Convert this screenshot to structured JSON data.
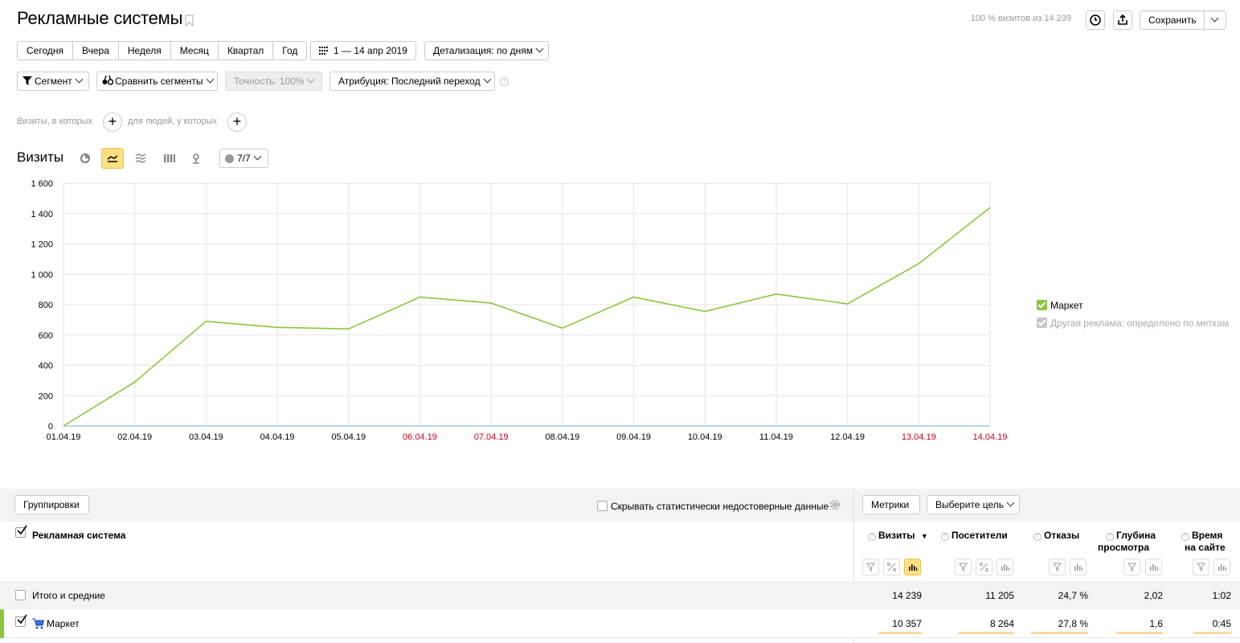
{
  "header": {
    "title": "Рекламные системы",
    "visits_info": "100 % визитов из 14 239",
    "save_label": "Сохранить"
  },
  "period": {
    "buttons": [
      "Сегодня",
      "Вчера",
      "Неделя",
      "Месяц",
      "Квартал",
      "Год"
    ],
    "date_range": "1 — 14 апр 2019",
    "detail": "Детализация: по дням"
  },
  "filters": {
    "segment": "Сегмент",
    "compare": "Сравнить сегменты",
    "accuracy": "Точность: 100%",
    "attribution": "Атрибуция: Последний переход"
  },
  "conditions": {
    "visits_label": "Визиты, в которых",
    "people_label": "для людей, у которых"
  },
  "chart_section": {
    "title": "Визиты",
    "series_counter": "7/7"
  },
  "chart_data": {
    "type": "line",
    "x": [
      "01.04.19",
      "02.04.19",
      "03.04.19",
      "04.04.19",
      "05.04.19",
      "06.04.19",
      "07.04.19",
      "08.04.19",
      "09.04.19",
      "10.04.19",
      "11.04.19",
      "12.04.19",
      "13.04.19",
      "14.04.19"
    ],
    "weekend": [
      false,
      false,
      false,
      false,
      false,
      true,
      true,
      false,
      false,
      false,
      false,
      false,
      true,
      true
    ],
    "yticks": [
      0,
      200,
      400,
      600,
      800,
      1000,
      1200,
      1400,
      1600
    ],
    "ytick_labels": [
      "0",
      "200",
      "400",
      "600",
      "800",
      "1 000",
      "1 200",
      "1 400",
      "1 600"
    ],
    "ylim": [
      0,
      1600
    ],
    "series": [
      {
        "name": "Маркет",
        "color": "#8cc63f",
        "values": [
          0,
          290,
          690,
          650,
          640,
          850,
          810,
          645,
          850,
          755,
          870,
          805,
          1070,
          1440
        ]
      },
      {
        "name": "Другая реклама: определено по меткам",
        "color": "#9ecae1",
        "values": [
          0,
          0,
          0,
          0,
          0,
          0,
          0,
          0,
          0,
          0,
          0,
          0,
          0,
          0
        ]
      }
    ],
    "grid": true,
    "legend": "right"
  },
  "table_toolbar": {
    "groupings": "Группировки",
    "hide_label": "Скрывать статистически недостоверные данные",
    "metrics": "Метрики",
    "goal": "Выберите цель"
  },
  "table": {
    "dimension_header": "Рекламная система",
    "columns": [
      {
        "label": "Визиты",
        "sorted": "▼"
      },
      {
        "label": "Посетители"
      },
      {
        "label": "Отказы"
      },
      {
        "label": "Глубина просмотра",
        "line1": "Глубина",
        "line2": "просмотра"
      },
      {
        "label": "Время на сайте",
        "line1": "Время",
        "line2": "на сайте"
      }
    ],
    "total": {
      "label": "Итого и средние",
      "values": [
        "14 239",
        "11 205",
        "24,7 %",
        "2,02",
        "1:02"
      ]
    },
    "rows": [
      {
        "label": "Маркет",
        "values": [
          "10 357",
          "8 264",
          "27,8 %",
          "1,6",
          "0:45"
        ],
        "bars": [
          0.73,
          0.74,
          1.0,
          0.8,
          0.73
        ]
      }
    ]
  }
}
